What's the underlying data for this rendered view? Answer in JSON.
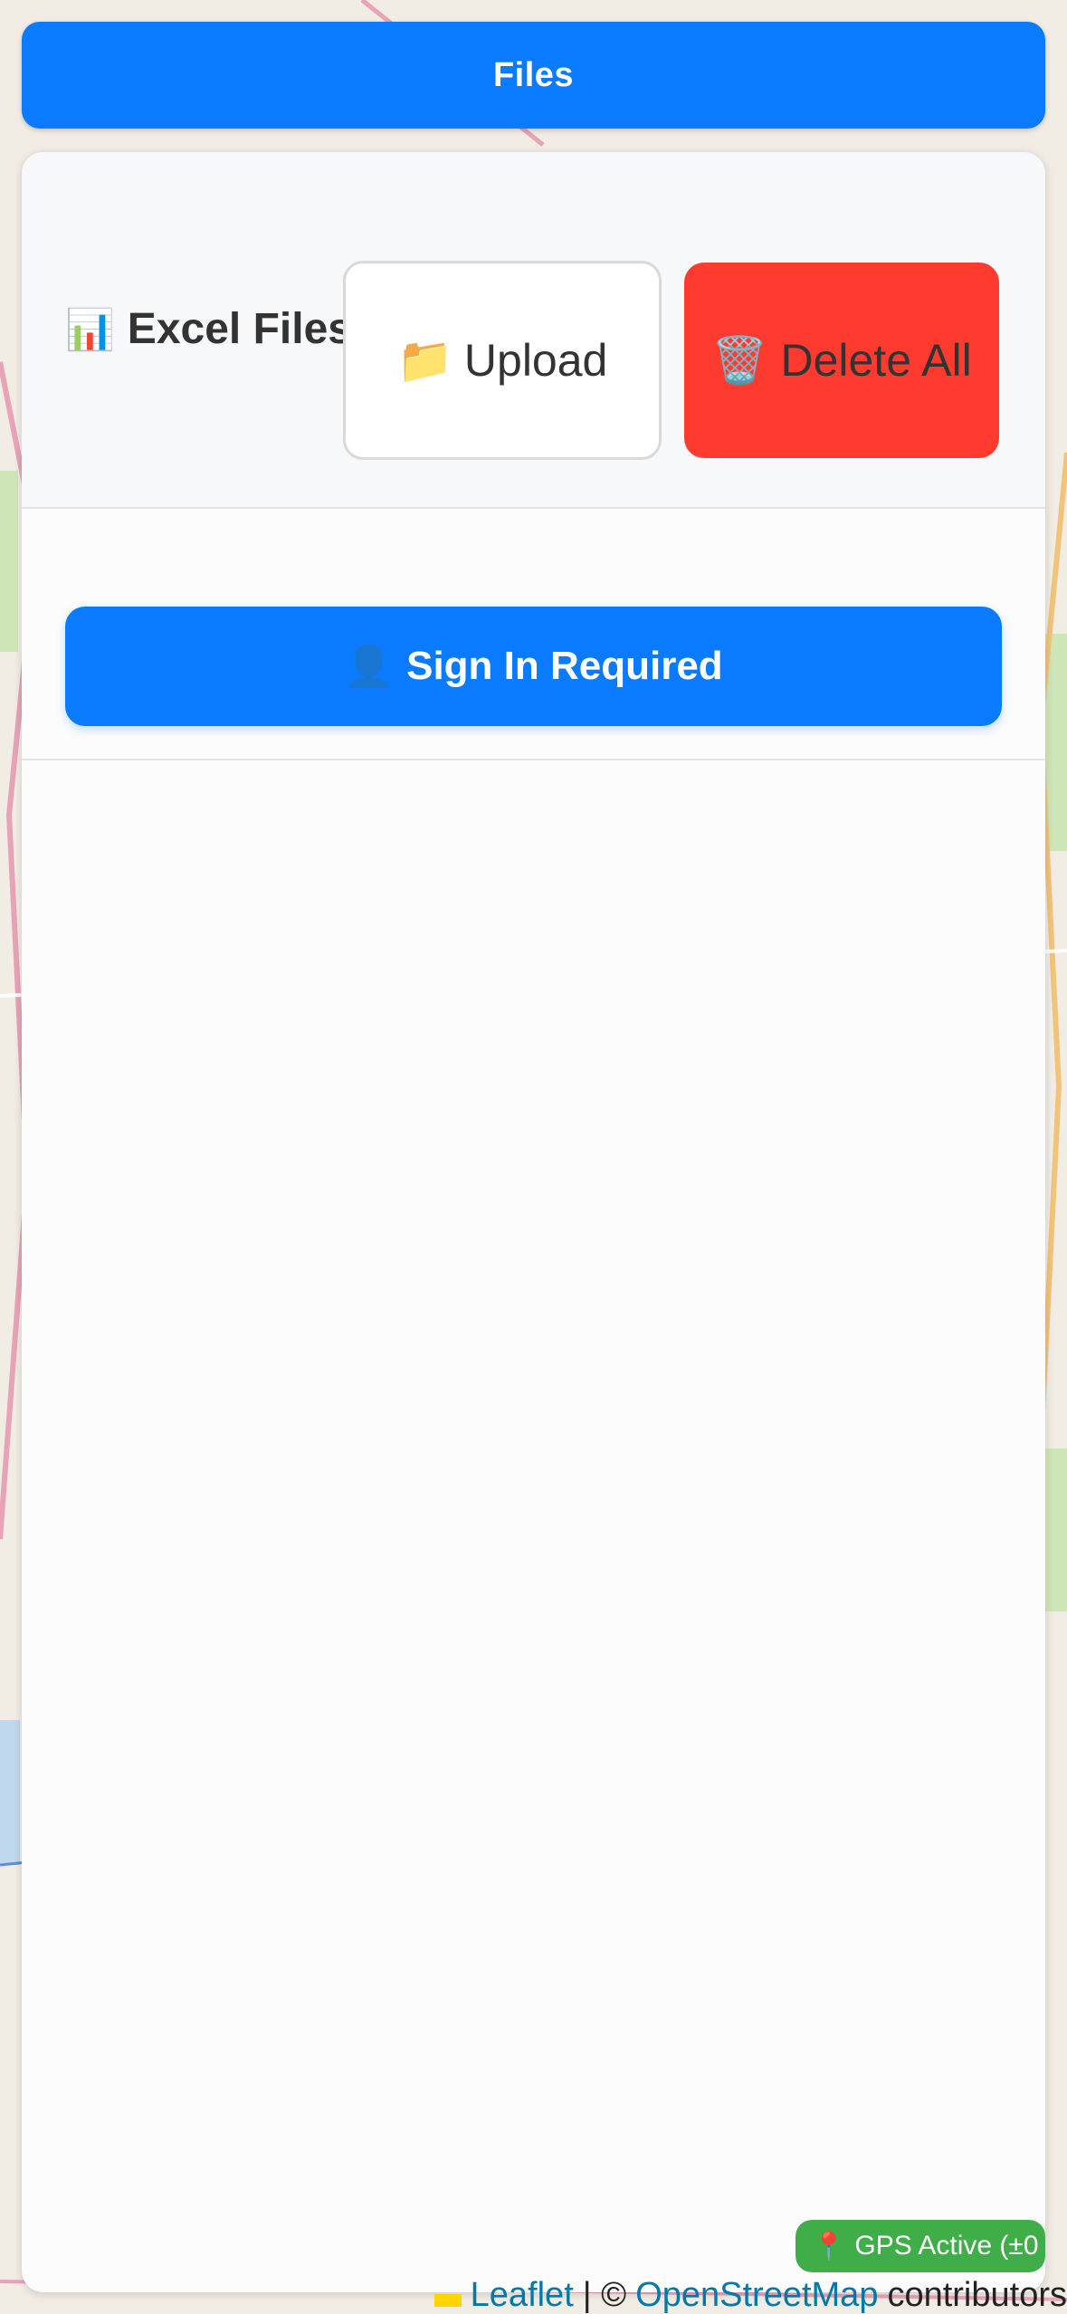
{
  "topbar": {
    "label": "Files"
  },
  "panel": {
    "title_icon": "📊",
    "title": "Excel Files",
    "upload": {
      "icon": "📁",
      "label": "Upload"
    },
    "delete_all": {
      "icon": "🗑️",
      "label": "Delete All"
    },
    "signin": {
      "icon": "👤",
      "label": "Sign In Required"
    }
  },
  "gps": {
    "icon": "📍",
    "label": "GPS Active (±0"
  },
  "attribution": {
    "leaflet": "Leaflet",
    "separator": "| ©",
    "osm": "OpenStreetMap",
    "contributors": "contributors"
  },
  "colors": {
    "primary": "#0a7bff",
    "danger": "#ff3b30",
    "gps": "#3fae49"
  }
}
